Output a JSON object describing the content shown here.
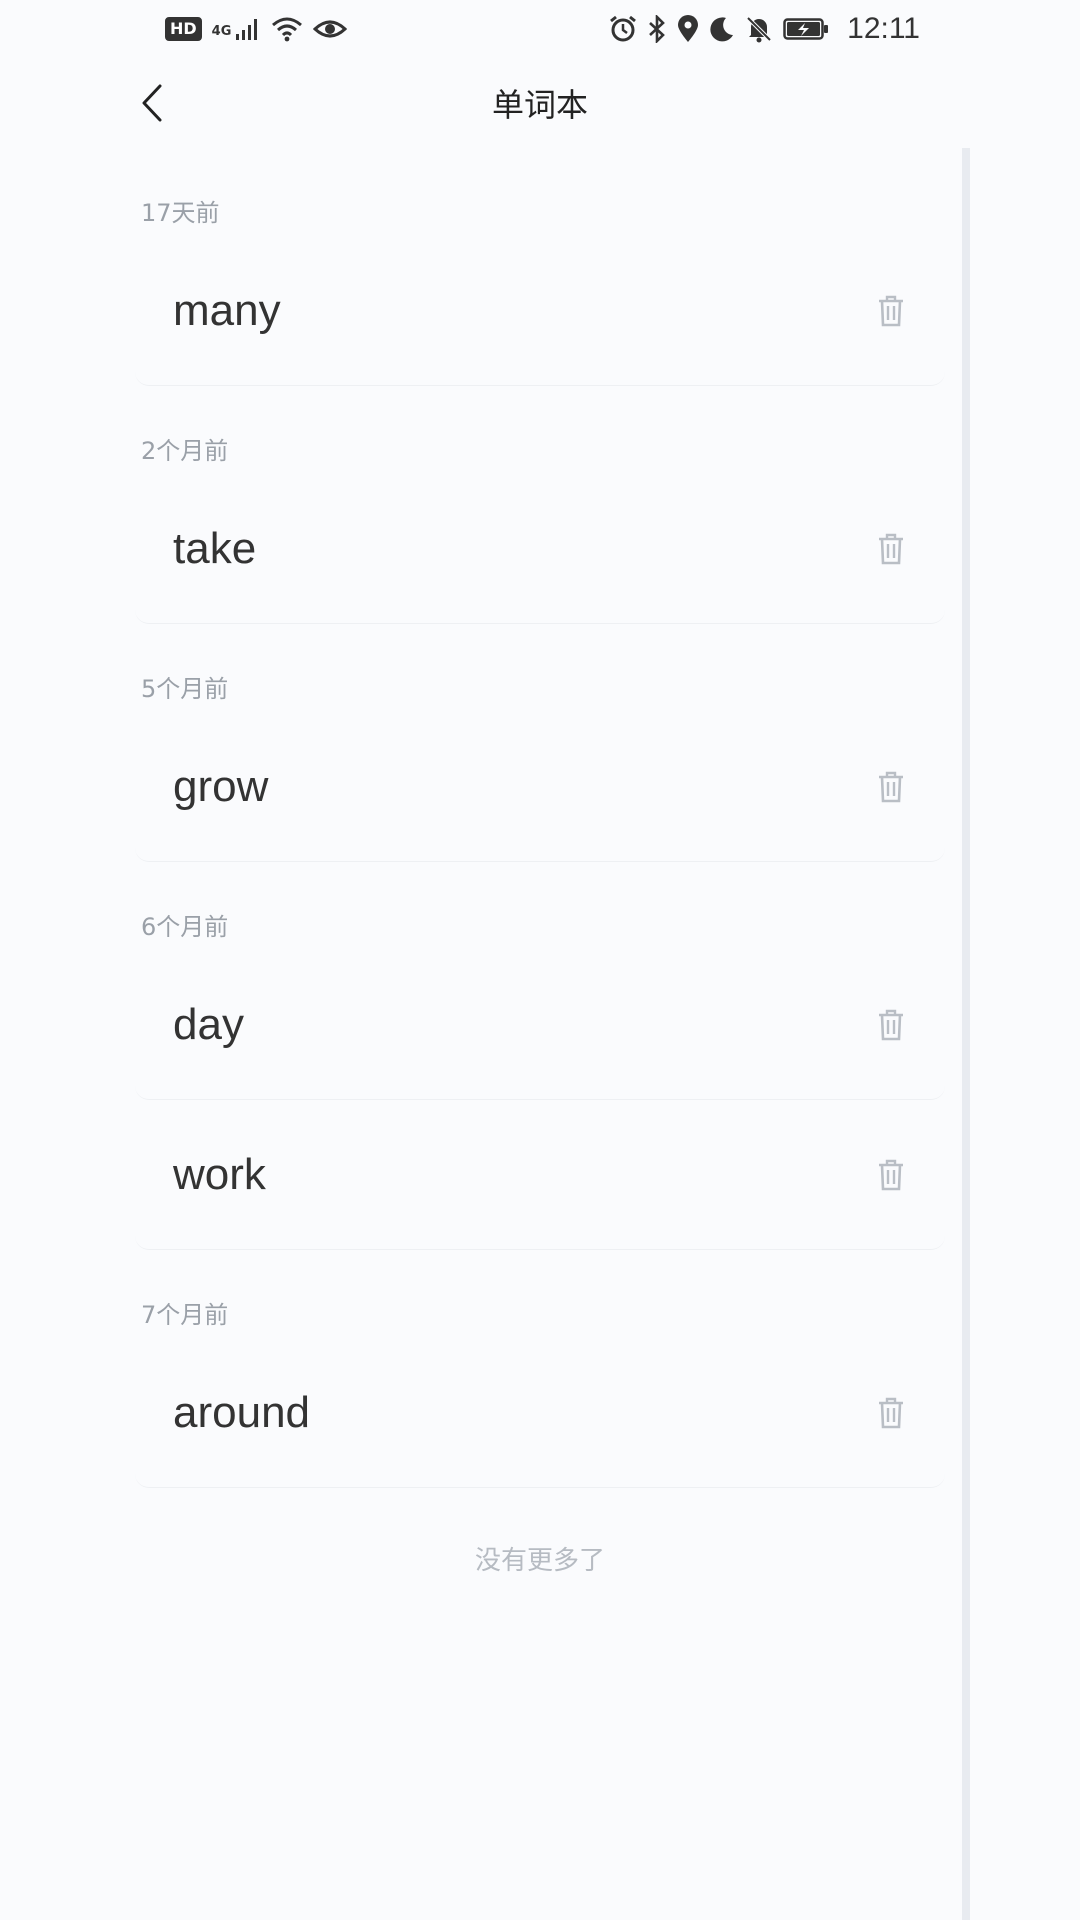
{
  "status_bar": {
    "hd": "HD",
    "network": "4G",
    "time": "12:11"
  },
  "header": {
    "title": "单词本"
  },
  "groups": [
    {
      "label": "17天前",
      "words": [
        "many"
      ]
    },
    {
      "label": "2个月前",
      "words": [
        "take"
      ]
    },
    {
      "label": "5个月前",
      "words": [
        "grow"
      ]
    },
    {
      "label": "6个月前",
      "words": [
        "day",
        "work"
      ]
    },
    {
      "label": "7个月前",
      "words": [
        "around"
      ]
    }
  ],
  "footer": {
    "no_more": "没有更多了"
  },
  "icons": {
    "back": "chevron-left-icon",
    "delete": "trash-icon"
  },
  "colors": {
    "background": "#fafbfd",
    "word_text": "#333333",
    "group_label": "#9aa0a8",
    "icon_gray": "#b9bec5"
  }
}
